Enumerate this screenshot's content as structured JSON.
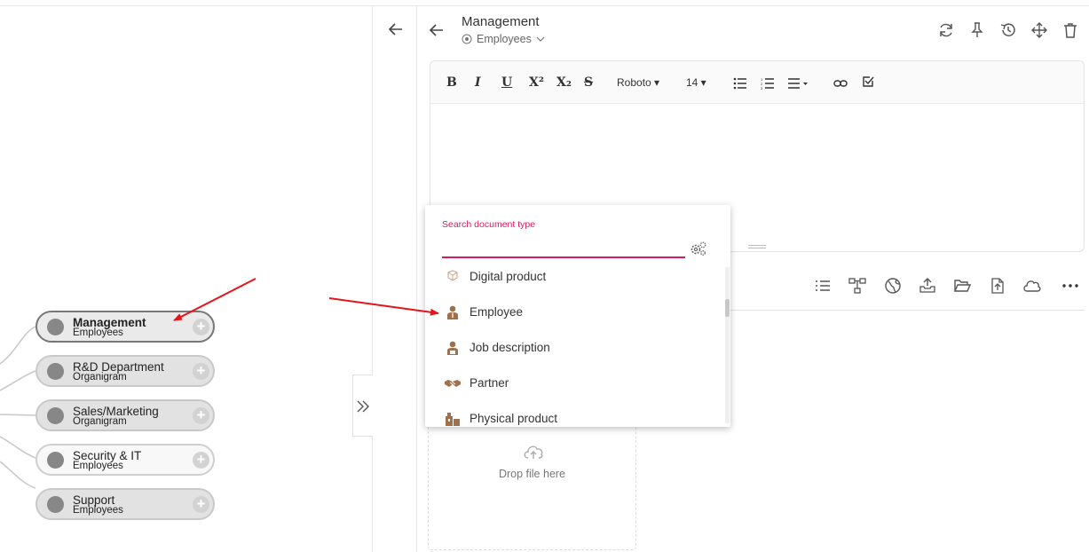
{
  "tree": {
    "nodes": [
      {
        "title": "Management",
        "subtitle": "Employees",
        "state": "selected"
      },
      {
        "title": "R&D Department",
        "subtitle": "Organigram",
        "state": "normal"
      },
      {
        "title": "Sales/Marketing",
        "subtitle": "Organigram",
        "state": "normal"
      },
      {
        "title": "Security & IT",
        "subtitle": "Employees",
        "state": "light"
      },
      {
        "title": "Support",
        "subtitle": "Employees",
        "state": "normal"
      }
    ],
    "add_icon": "+"
  },
  "header": {
    "title": "Management",
    "type_label": "Employees",
    "icons": [
      "sync-icon",
      "pin-icon",
      "history-icon",
      "move-icon",
      "trash-icon"
    ]
  },
  "editor": {
    "toolbar": {
      "bold": "B",
      "italic": "I",
      "underline": "U",
      "superscript": "X²",
      "subscript": "X₂",
      "strike": "S",
      "font": "Roboto ▾",
      "size": "14 ▾"
    }
  },
  "secondary_toolbar": {
    "icons": [
      "list-icon",
      "hierarchy-icon",
      "globe-icon",
      "upload-tray-icon",
      "folder-open-icon",
      "file-upload-icon",
      "cloud-icon",
      "more-icon"
    ]
  },
  "dropzone": {
    "label": "Drop file here"
  },
  "dropdown": {
    "search_label": "Search document type",
    "search_value": "",
    "items": [
      {
        "label": "Digital product",
        "icon": "digital-product-icon"
      },
      {
        "label": "Employee",
        "icon": "employee-icon"
      },
      {
        "label": "Job description",
        "icon": "job-description-icon"
      },
      {
        "label": "Partner",
        "icon": "handshake-icon"
      },
      {
        "label": "Physical product",
        "icon": "physical-product-icon"
      }
    ]
  },
  "colors": {
    "accent": "#d81b60",
    "icon_brown": "#a0704a",
    "annotation_arrow": "#e8141b"
  }
}
